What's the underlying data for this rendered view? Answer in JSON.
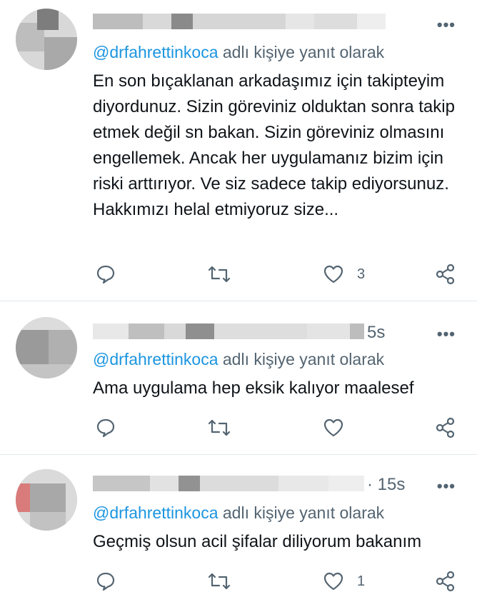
{
  "tweets": [
    {
      "time": "",
      "reply_prefix": "@drfahrettinkoca",
      "reply_suffix": " adlı kişiye yanıt olarak",
      "text": "En son bıçaklanan arkadaşımız için takipteyim diyordunuz. Sizin göreviniz olduktan sonra takip etmek değil sn bakan. Sizin göreviniz olmasını engellemek. Ancak her uygulamanız bizim için riski arttırıyor. Ve siz sadece takip ediyorsunuz. Hakkımızı helal etmiyoruz size...",
      "like_count": "3",
      "more": "•••"
    },
    {
      "time": "5s",
      "reply_prefix": "@drfahrettinkoca",
      "reply_suffix": " adlı kişiye yanıt olarak",
      "text": "Ama uygulama hep eksik kalıyor maalesef",
      "like_count": "",
      "more": "•••"
    },
    {
      "time": "· 15s",
      "reply_prefix": "@drfahrettinkoca",
      "reply_suffix": " adlı kişiye yanıt olarak",
      "text": "Geçmiş olsun acil şifalar diliyorum bakanım",
      "like_count": "1",
      "more": "•••"
    }
  ],
  "icons": {
    "reply": "reply-icon",
    "retweet": "retweet-icon",
    "like": "heart-icon",
    "share": "share-icon"
  },
  "colors": {
    "mention": "#1b95e0",
    "secondary": "#536471",
    "text": "#0f1419",
    "divider": "#e1e8ed"
  }
}
